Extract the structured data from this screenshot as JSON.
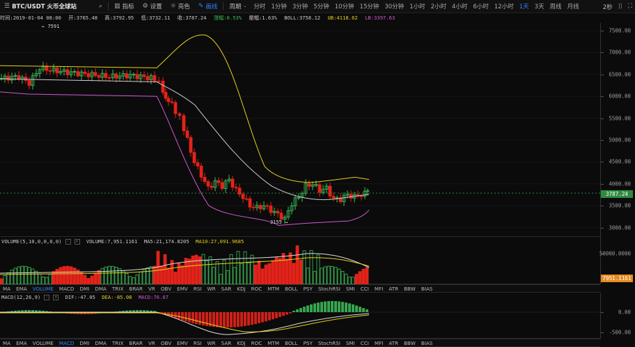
{
  "topbar": {
    "symbol": "BTC/USDT 火币全球站",
    "indicators_label": "指标",
    "settings_label": "设置",
    "theme_label": "亮色",
    "draw_label": "画线",
    "period_label": "周期",
    "timeframes": [
      "分时",
      "1分钟",
      "3分钟",
      "5分钟",
      "10分钟",
      "15分钟",
      "30分钟",
      "1小时",
      "2小时",
      "4小时",
      "6小时",
      "12小时",
      "1天",
      "3天",
      "周线",
      "月线"
    ],
    "active_timeframe": "1天",
    "refresh": "2秒"
  },
  "info": {
    "time": "时间:2019-01-04 08:00",
    "open": "开:3765.48",
    "high": "高:3792.95",
    "low": "低:3732.11",
    "close": "收:3787.24",
    "change": "涨幅:0.53%",
    "amplitude": "振幅:1.63%",
    "boll": "BOLL:3758.12",
    "ub": "UB:4118.62",
    "lb": "LB:3397.63"
  },
  "price_axis": {
    "ticks": [
      "7500.00",
      "7000.00",
      "6500.00",
      "6000.00",
      "5500.00",
      "5000.00",
      "4500.00",
      "4000.00",
      "3500.00",
      "3000.00"
    ],
    "current": "3787.24"
  },
  "annotations": {
    "high": "7591",
    "low": "3155"
  },
  "volume": {
    "title": "VOLUME(5,10,0,0,0,0)",
    "volume": "VOLUME:7,951.1161",
    "ma5": "MA5:21,174.8205",
    "ma10": "MA10:27,091.9685",
    "axis_tick": "50000.0000",
    "current": "7951.1161"
  },
  "indicator_tabs": [
    "MA",
    "EMA",
    "VOLUME",
    "MACD",
    "DMI",
    "DMA",
    "TRIX",
    "BRAR",
    "VR",
    "OBV",
    "EMV",
    "RSI",
    "WR",
    "SAR",
    "KDJ",
    "ROC",
    "MTM",
    "BOLL",
    "PSY",
    "StochRSI",
    "SMI",
    "CCI",
    "MFI",
    "ATR",
    "BBW",
    "BIAS"
  ],
  "indicator_tabs_active_top": "VOLUME",
  "indicator_tabs_active_bottom": "MACD",
  "macd": {
    "title": "MACD(12,26,9)",
    "dif": "DIF:-47.05",
    "dea": "DEA:-85.08",
    "macd": "MACD:76.07",
    "axis_ticks": [
      "0.00",
      "-500.00"
    ]
  },
  "colors": {
    "up": "#3fbf5a",
    "down": "#e2231a",
    "ub": "#e6d11a",
    "lb": "#d259d2",
    "mid": "#cfcfcf",
    "accent": "#2f86ff",
    "price_tag": "#2f8a3e",
    "vol_tag": "#e58a1f"
  }
}
